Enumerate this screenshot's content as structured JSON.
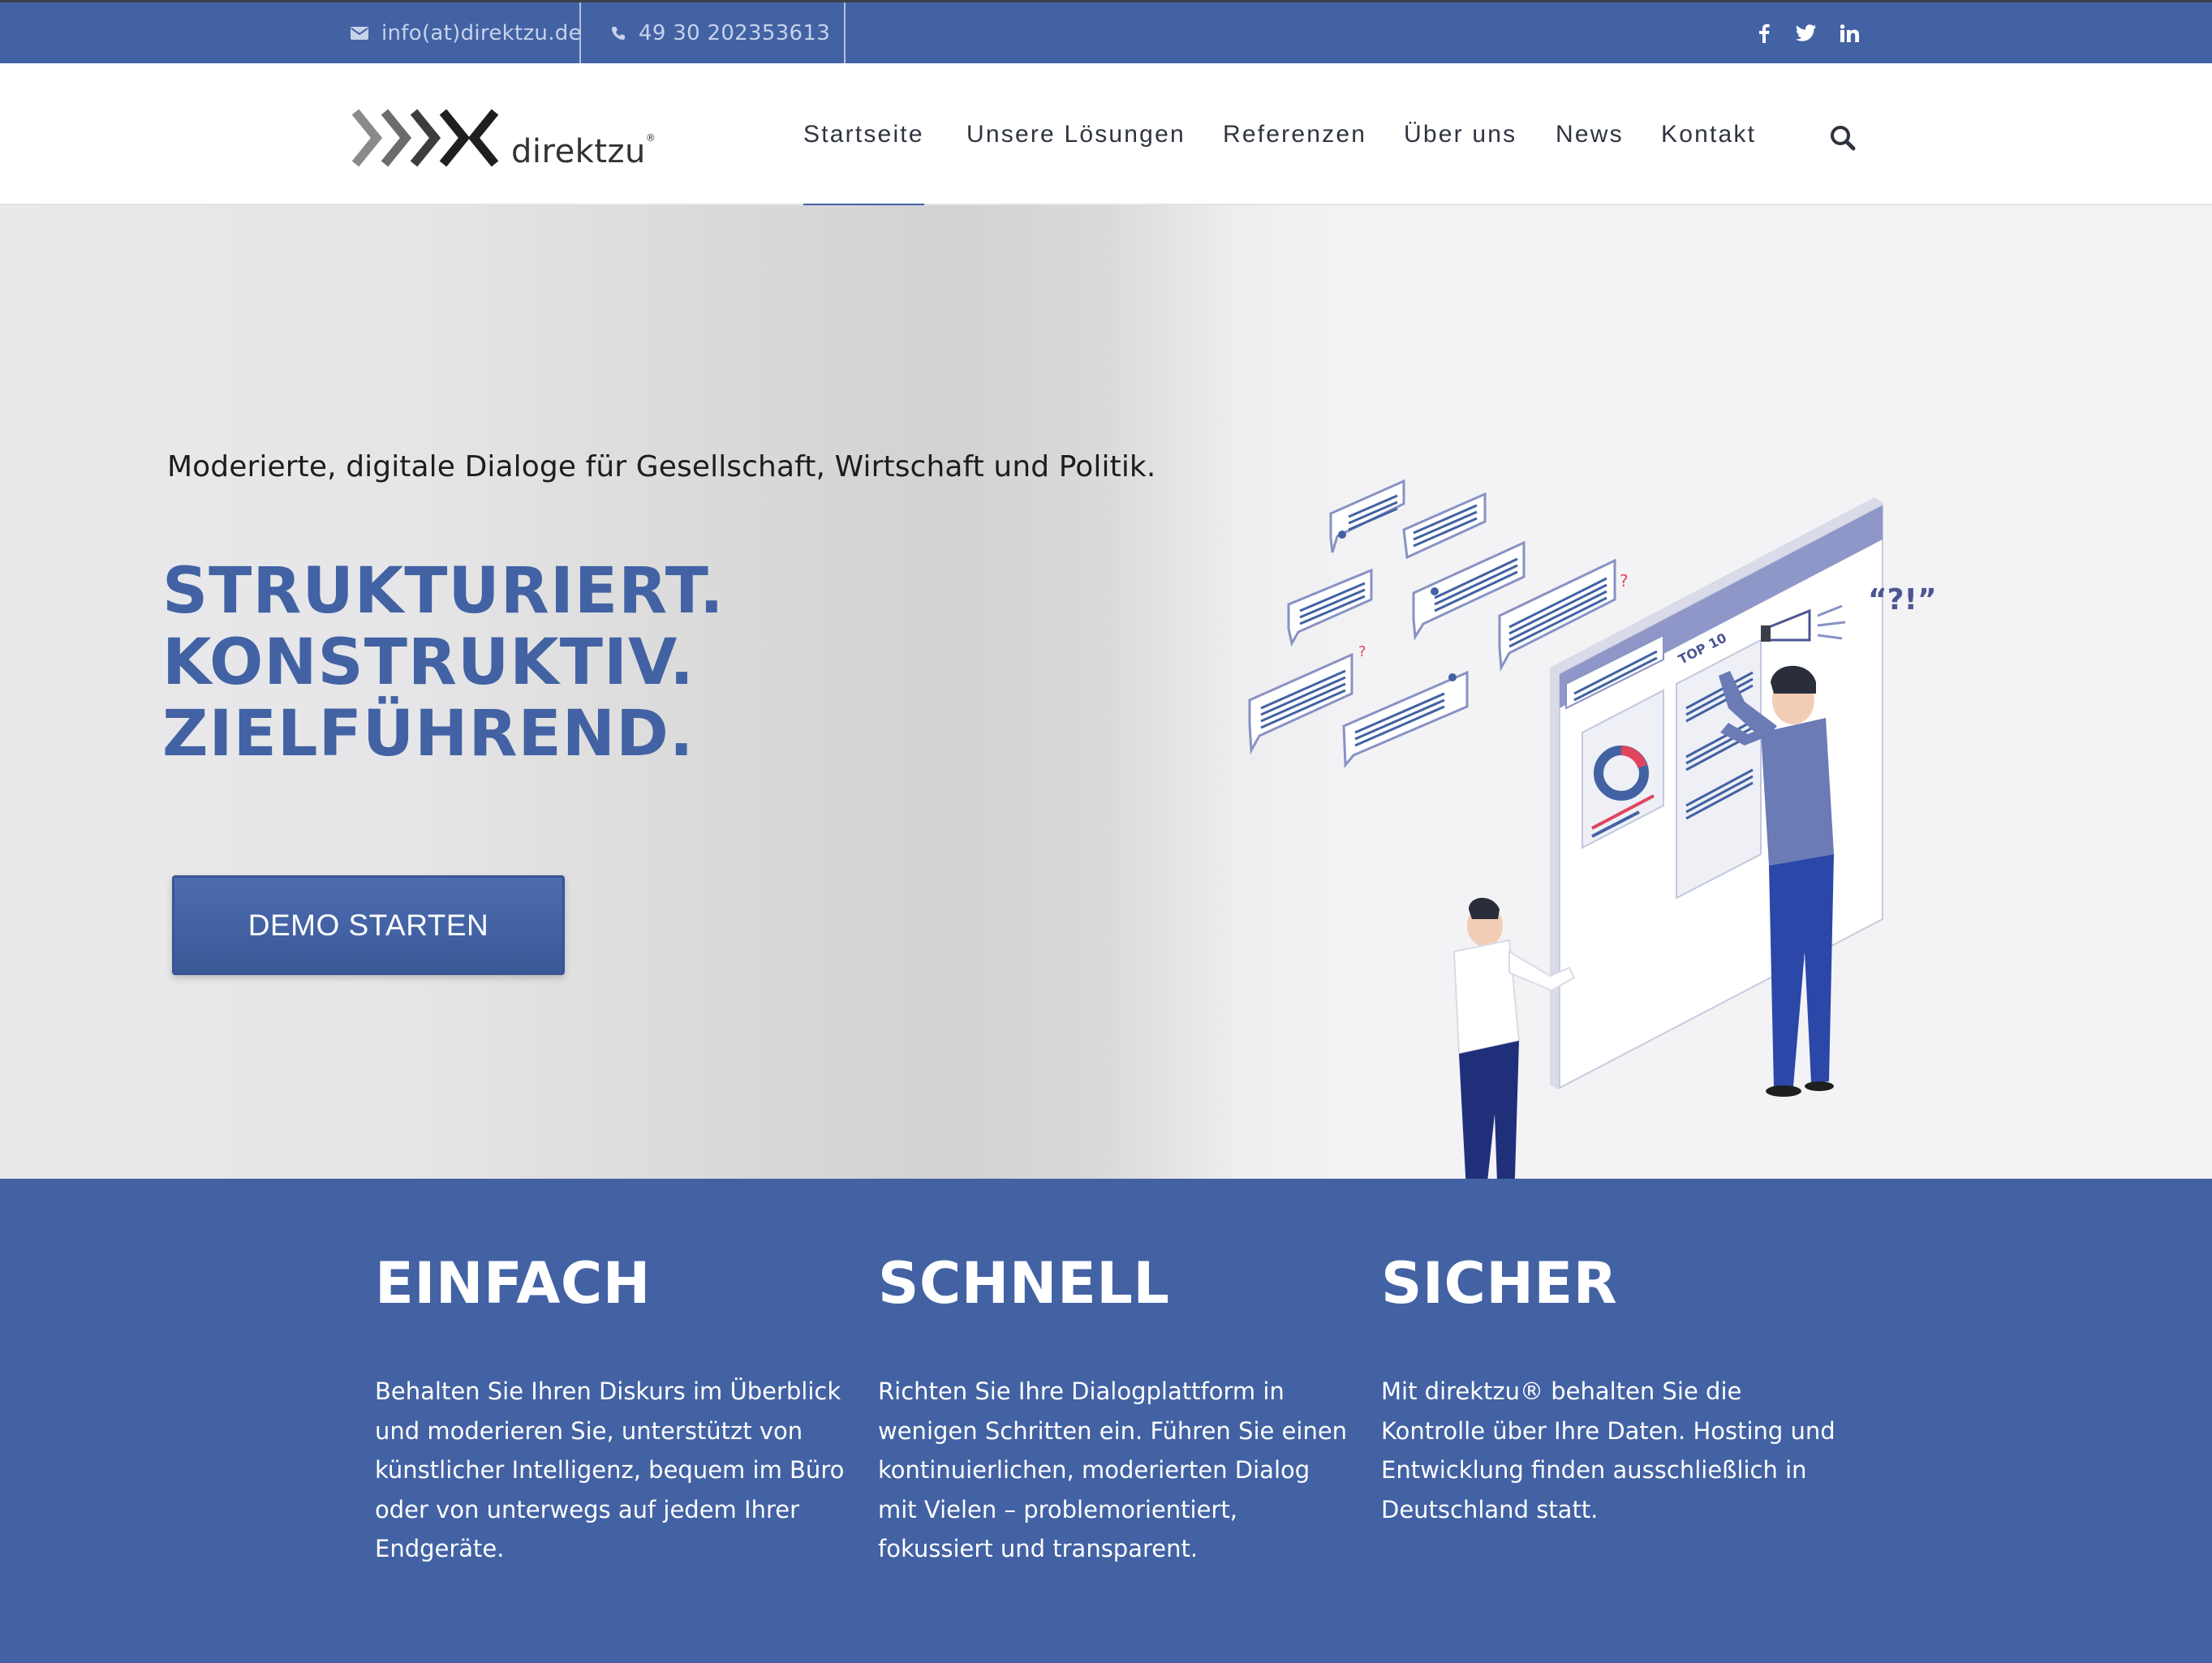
{
  "topbar": {
    "email": "info(at)direktzu.de",
    "phone": "49 30 202353613",
    "social": [
      "facebook-icon",
      "twitter-icon",
      "linkedin-icon"
    ]
  },
  "header": {
    "logo_text": "direktzu",
    "logo_mark": "®",
    "nav": [
      {
        "label": "Startseite",
        "active": true
      },
      {
        "label": "Unsere Lösungen",
        "active": false
      },
      {
        "label": "Referenzen",
        "active": false
      },
      {
        "label": "Über uns",
        "active": false
      },
      {
        "label": "News",
        "active": false
      },
      {
        "label": "Kontakt",
        "active": false
      }
    ],
    "search_icon": "search-icon"
  },
  "hero": {
    "subtitle": "Moderierte, digitale Dialoge für Gesellschaft, Wirtschaft und Politik.",
    "headline": [
      "STRUKTURIERT.",
      "KONSTRUKTIV.",
      "ZIELFÜHREND."
    ],
    "cta_label": "DEMO STARTEN",
    "illustration_labels": {
      "top10": "TOP 10",
      "quote": "“?!”",
      "question": "?"
    }
  },
  "features": [
    {
      "title": "EINFACH",
      "text": "Behalten Sie Ihren Diskurs im Überblick und moderieren Sie, unterstützt von künstlicher Intelligenz, bequem im Büro oder von unterwegs auf jedem Ihrer Endgeräte."
    },
    {
      "title": "SCHNELL",
      "text": "Richten Sie Ihre Dialogplattform in wenigen Schritten ein. Führen Sie einen kontinuierlichen, moderierten Dialog mit Vielen – problemorientiert, fokussiert und transparent."
    },
    {
      "title": "SICHER",
      "text": "Mit direktzu® behalten Sie die Kontrolle über Ihre Daten. Hosting und Entwicklung finden ausschließlich in Deutschland statt."
    }
  ],
  "colors": {
    "brand_blue": "#4262a4",
    "topbar_text": "#c8d2ea",
    "accent_red": "#e0455d"
  }
}
